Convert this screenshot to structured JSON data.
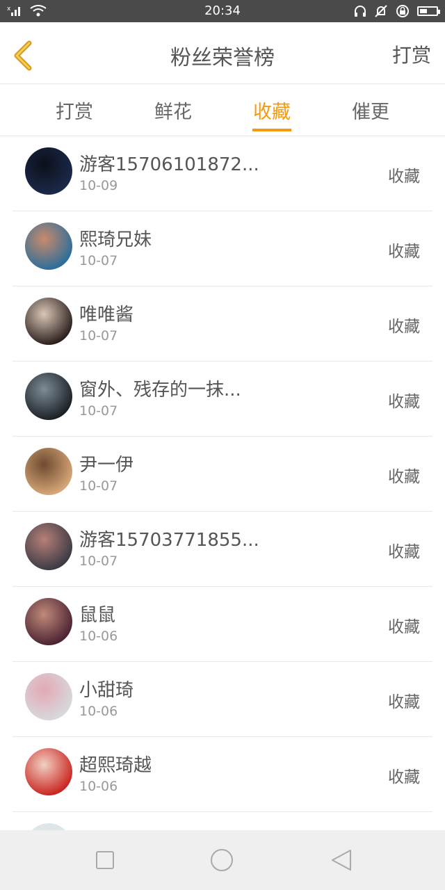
{
  "status_bar": {
    "time": "20:34",
    "icons": [
      "no-sim-signal-icon",
      "wifi-icon",
      "headphones-icon",
      "bell-muted-icon",
      "rotation-lock-icon",
      "battery-icon"
    ],
    "battery_level": 0.45
  },
  "header": {
    "title": "粉丝荣誉榜",
    "action_label": "打赏",
    "back_icon": "chevron-left-icon",
    "accent": "#f29b12"
  },
  "tabs": [
    {
      "label": "打赏",
      "active": false
    },
    {
      "label": "鲜花",
      "active": false
    },
    {
      "label": "收藏",
      "active": true
    },
    {
      "label": "催更",
      "active": false
    }
  ],
  "list": [
    {
      "name": "游客15706101872...",
      "date": "10-09",
      "type": "收藏",
      "avatar_colors": [
        "#1b2a4a",
        "#0c0f1a"
      ]
    },
    {
      "name": "熙琦兄妹",
      "date": "10-07",
      "type": "收藏",
      "avatar_colors": [
        "#2b6d9b",
        "#c98a6a"
      ]
    },
    {
      "name": "唯唯酱",
      "date": "10-07",
      "type": "收藏",
      "avatar_colors": [
        "#2a1d1a",
        "#d9c7b8"
      ]
    },
    {
      "name": "窗外、残存的一抹...",
      "date": "10-07",
      "type": "收藏",
      "avatar_colors": [
        "#1a1f24",
        "#7d8c97"
      ]
    },
    {
      "name": "尹一伊",
      "date": "10-07",
      "type": "收藏",
      "avatar_colors": [
        "#d8a879",
        "#6d4a30"
      ]
    },
    {
      "name": "游客15703771855...",
      "date": "10-07",
      "type": "收藏",
      "avatar_colors": [
        "#3a3a44",
        "#b77f78"
      ]
    },
    {
      "name": "鼠鼠",
      "date": "10-06",
      "type": "收藏",
      "avatar_colors": [
        "#4a2231",
        "#c08a7a"
      ]
    },
    {
      "name": "小甜琦",
      "date": "10-06",
      "type": "收藏",
      "avatar_colors": [
        "#d7d9dd",
        "#e4a8b4"
      ]
    },
    {
      "name": "超熙琦越",
      "date": "10-06",
      "type": "收藏",
      "avatar_colors": [
        "#c9241f",
        "#f1d0c3"
      ]
    }
  ],
  "nav_bar": {
    "buttons": [
      "recent-apps-icon",
      "home-icon",
      "back-icon"
    ]
  }
}
